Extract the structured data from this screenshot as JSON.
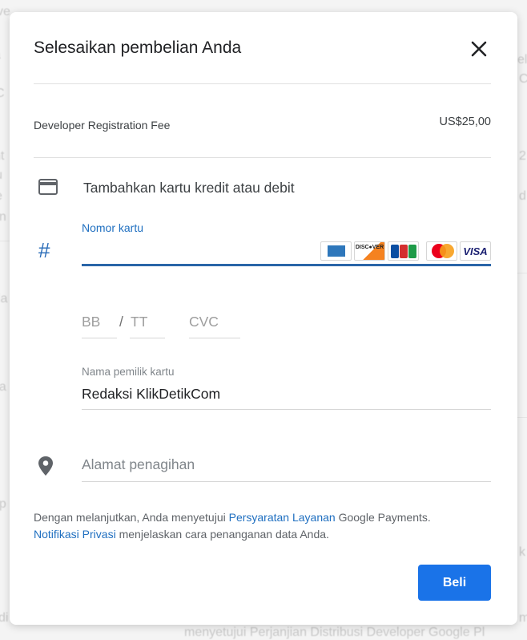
{
  "background": {
    "fragments": [
      "ve",
      "a",
      "t",
      "C",
      "nt",
      "u",
      "e",
      "en",
      "ela",
      "pa",
      "ep",
      "el",
      "C",
      "2",
      "d",
      "k",
      "di",
      "m",
      "menyetujui Perjanjian Distribusi Developer Google Pl"
    ]
  },
  "dialog": {
    "title": "Selesaikan pembelian Anda",
    "close_icon": "close-icon",
    "item": {
      "label": "Developer Registration Fee",
      "price": "US$25,00"
    },
    "add_card": {
      "icon": "credit-card-icon",
      "label": "Tambahkan kartu kredit atau debit"
    },
    "card_number": {
      "icon": "hash-icon",
      "label": "Nomor kartu",
      "value": "",
      "accepted_cards": [
        "American Express",
        "Discover",
        "JCB",
        "MasterCard",
        "VISA"
      ]
    },
    "expiry": {
      "month_placeholder": "BB",
      "separator": "/",
      "year_placeholder": "TT"
    },
    "cvc": {
      "placeholder": "CVC"
    },
    "cardholder": {
      "label": "Nama pemilik kartu",
      "value": "Redaksi KlikDetikCom"
    },
    "billing_address": {
      "icon": "location-pin-icon",
      "placeholder": "Alamat penagihan"
    },
    "legal": {
      "text1": "Dengan melanjutkan, Anda menyetujui ",
      "link1": "Persyaratan Layanan",
      "text2": " Google Payments.",
      "link2": "Notifikasi Privasi",
      "text3": " menjelaskan cara penanganan data Anda."
    },
    "buy_button": "Beli"
  },
  "colors": {
    "primary": "#1a73e8",
    "link": "#1f6fc0",
    "focus_underline": "#2a65a8"
  }
}
